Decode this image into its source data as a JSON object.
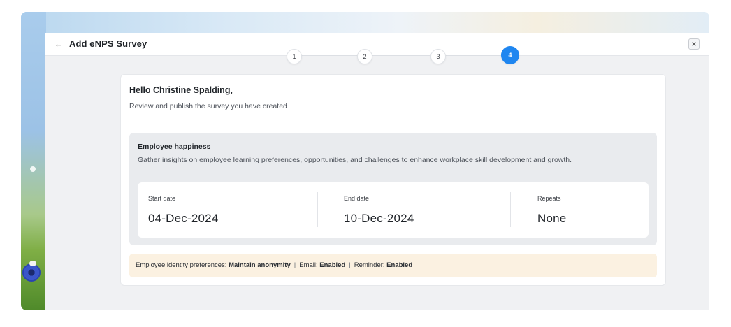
{
  "header": {
    "back_icon": "←",
    "title": "Add eNPS Survey",
    "close_icon": "×"
  },
  "stepper": {
    "steps": [
      "1",
      "2",
      "3",
      "4"
    ],
    "active_step": 4,
    "active_color": "#1f86f0"
  },
  "card": {
    "greeting": "Hello Christine Spalding,",
    "subtext": "Review and publish the survey you have created"
  },
  "survey": {
    "title": "Employee happiness",
    "description": "Gather insights on employee learning preferences, opportunities, and challenges to enhance workplace skill development and growth.",
    "start_label": "Start date",
    "start_value": "04-Dec-2024",
    "end_label": "End date",
    "end_value": "10-Dec-2024",
    "repeats_label": "Repeats",
    "repeats_value": "None"
  },
  "preferences": {
    "identity_label": "Employee identity preferences: ",
    "identity_value": "Maintain anonymity",
    "separator": "|",
    "email_label": "Email: ",
    "email_value": "Enabled",
    "reminder_label": "Reminder: ",
    "reminder_value": "Enabled",
    "background_color": "#fbf1e1"
  }
}
